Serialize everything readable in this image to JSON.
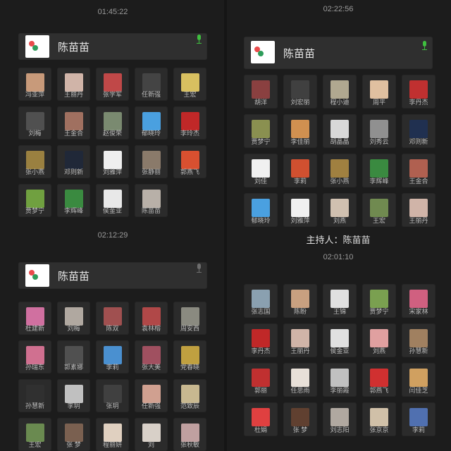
{
  "messages": [
    {
      "timestamp": "01:45:22",
      "host_name": "陈苗苗",
      "mic_active": true,
      "participants": [
        {
          "name": "冯亚萍",
          "color": "#c89a7a"
        },
        {
          "name": "王丽丹",
          "color": "#d0b4a8"
        },
        {
          "name": "张学军",
          "color": "#c04848"
        },
        {
          "name": "任新强",
          "color": "#444444"
        },
        {
          "name": "王宏",
          "color": "#d8c060"
        },
        {
          "name": "刘梅",
          "color": "#505050"
        },
        {
          "name": "王金合",
          "color": "#a07060"
        },
        {
          "name": "赵俊荣",
          "color": "#7a8a70"
        },
        {
          "name": "郁晓玲",
          "color": "#4aa0e0"
        },
        {
          "name": "李玲杰",
          "color": "#c02828"
        },
        {
          "name": "张小燕",
          "color": "#9a8040"
        },
        {
          "name": "邓则新",
          "color": "#202838"
        },
        {
          "name": "刘雅萍",
          "color": "#efefef"
        },
        {
          "name": "张静丽",
          "color": "#8a7a6a"
        },
        {
          "name": "郭燕飞",
          "color": "#d85030"
        },
        {
          "name": "贾梦宁",
          "color": "#70a040"
        },
        {
          "name": "李辉峰",
          "color": "#3a8a40"
        },
        {
          "name": "侯金亚",
          "color": "#e8e8e8"
        },
        {
          "name": "陈苗苗",
          "color": "#b8b0a8"
        }
      ]
    },
    {
      "timestamp": "02:12:29",
      "host_name": "陈苗苗",
      "mic_active": false,
      "participants": [
        {
          "name": "杜建新",
          "color": "#d070a0"
        },
        {
          "name": "刘梅",
          "color": "#b0a8a0"
        },
        {
          "name": "陈双",
          "color": "#a05050"
        },
        {
          "name": "袁林榕",
          "color": "#b04848"
        },
        {
          "name": "周安西",
          "color": "#8a8a80"
        },
        {
          "name": "孙瑞东",
          "color": "#d07090"
        },
        {
          "name": "郭素娜",
          "color": "#505050"
        },
        {
          "name": "李莉",
          "color": "#4a90d0"
        },
        {
          "name": "张大美",
          "color": "#a05060"
        },
        {
          "name": "党春晓",
          "color": "#c0a040"
        },
        {
          "name": "孙慧新",
          "color": "#303030"
        },
        {
          "name": "李玥",
          "color": "#c0c0c0"
        },
        {
          "name": "张玥",
          "color": "#404040"
        },
        {
          "name": "任新强",
          "color": "#d0a090"
        },
        {
          "name": "范致辰",
          "color": "#c8b890"
        },
        {
          "name": "王宏",
          "color": "#6a8a50"
        },
        {
          "name": "张 梦",
          "color": "#7a6050"
        },
        {
          "name": "程丽妍",
          "color": "#e0d0c0"
        },
        {
          "name": "刘",
          "color": "#d8d0c8"
        },
        {
          "name": "张秋敏",
          "color": "#c0a0a0"
        }
      ]
    },
    {
      "timestamp": "02:22:56",
      "host_name": "陈苗苗",
      "mic_active": true,
      "participants": [
        {
          "name": "胡洋",
          "color": "#8a4040"
        },
        {
          "name": "刘宏丽",
          "color": "#404040"
        },
        {
          "name": "程小迪",
          "color": "#b0a890"
        },
        {
          "name": "周平",
          "color": "#e0c0a0"
        },
        {
          "name": "李丹杰",
          "color": "#c03030"
        },
        {
          "name": "贾梦宁",
          "color": "#8a9050"
        },
        {
          "name": "李佳丽",
          "color": "#d09050"
        },
        {
          "name": "胡晶晶",
          "color": "#d8d8d8"
        },
        {
          "name": "刘秀云",
          "color": "#909090"
        },
        {
          "name": "邓则新",
          "color": "#203050"
        },
        {
          "name": "刘佳",
          "color": "#f0f0f0"
        },
        {
          "name": "李莉",
          "color": "#d05030"
        },
        {
          "name": "张小燕",
          "color": "#a08040"
        },
        {
          "name": "李辉峰",
          "color": "#3a8a40"
        },
        {
          "name": "王金合",
          "color": "#b06050"
        },
        {
          "name": "郁晓玲",
          "color": "#4aa0e0"
        },
        {
          "name": "刘雅萍",
          "color": "#f0f0f0"
        },
        {
          "name": "刘燕",
          "color": "#d0c0b0"
        },
        {
          "name": "王宏",
          "color": "#708a50"
        },
        {
          "name": "王丽丹",
          "color": "#d0b4a8"
        }
      ],
      "host_line": "主持人：陈苗苗"
    },
    {
      "timestamp": "02:01:10",
      "participants": [
        {
          "name": "张志国",
          "color": "#8aa0b0"
        },
        {
          "name": "陈盼",
          "color": "#c8a080"
        },
        {
          "name": "王锦",
          "color": "#e0e0e0"
        },
        {
          "name": "贾梦宁",
          "color": "#7aa050"
        },
        {
          "name": "宋家林",
          "color": "#d06080"
        },
        {
          "name": "李丹杰",
          "color": "#c02828"
        },
        {
          "name": "王丽丹",
          "color": "#d0b4a8"
        },
        {
          "name": "侯金亚",
          "color": "#e0e0e0"
        },
        {
          "name": "刘燕",
          "color": "#e0a0a0"
        },
        {
          "name": "孙慧新",
          "color": "#a08060"
        },
        {
          "name": "郭丽",
          "color": "#c03030"
        },
        {
          "name": "任思雨",
          "color": "#e8e0d8"
        },
        {
          "name": "李丽霞",
          "color": "#c0c0c0"
        },
        {
          "name": "郭燕飞",
          "color": "#d03030"
        },
        {
          "name": "闫佳芝",
          "color": "#d0a060"
        },
        {
          "name": "杜娟",
          "color": "#e04040"
        },
        {
          "name": "张 梦",
          "color": "#604030"
        },
        {
          "name": "刘志阳",
          "color": "#b0a8a0"
        },
        {
          "name": "张京京",
          "color": "#d0c0a8"
        },
        {
          "name": "李莉",
          "color": "#5070b0"
        }
      ]
    }
  ]
}
